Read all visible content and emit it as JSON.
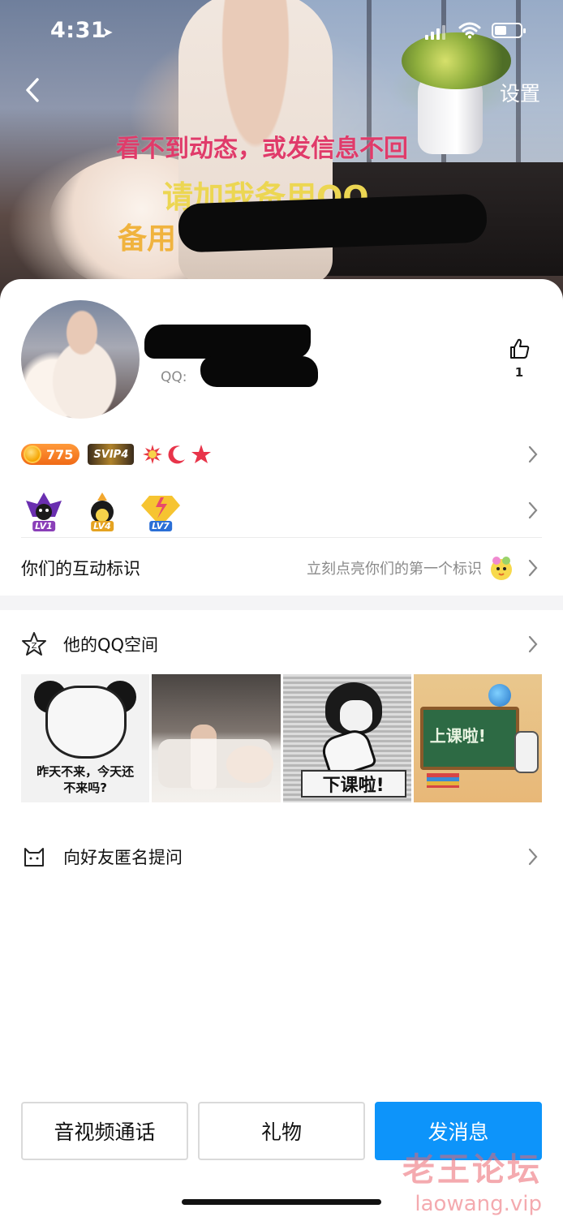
{
  "status_bar": {
    "time": "4:31"
  },
  "header": {
    "settings_label": "设置",
    "cover_text_line1": "看不到动态，或发信息不回",
    "cover_text_line2": "请加我备用QQ",
    "cover_text_line3": "备用"
  },
  "profile": {
    "qq_label": "QQ:",
    "like_count": "1"
  },
  "badges": {
    "coin_value": "775",
    "svip_label": "SVIP4"
  },
  "levels": [
    {
      "label": "LV1",
      "color": "#8a3fb8"
    },
    {
      "label": "LV4",
      "color": "#e5a321"
    },
    {
      "label": "LV7",
      "color": "#2b6fd6"
    }
  ],
  "interaction": {
    "label": "你们的互动标识",
    "hint": "立刻点亮你们的第一个标识"
  },
  "qzone": {
    "label": "他的QQ空间",
    "photos": [
      {
        "caption": "昨天不来，今天还\n不来吗?"
      },
      {
        "caption": ""
      },
      {
        "caption": "下课啦!"
      },
      {
        "caption": "上课啦!"
      }
    ]
  },
  "ask": {
    "label": "向好友匿名提问"
  },
  "actions": {
    "call_label": "音视频通话",
    "gift_label": "礼物",
    "message_label": "发消息"
  },
  "watermark": {
    "line1": "老王论坛",
    "line2": "laowang.vip"
  },
  "colors": {
    "primary_button": "#0d94fa",
    "coin": "#f06a16"
  }
}
